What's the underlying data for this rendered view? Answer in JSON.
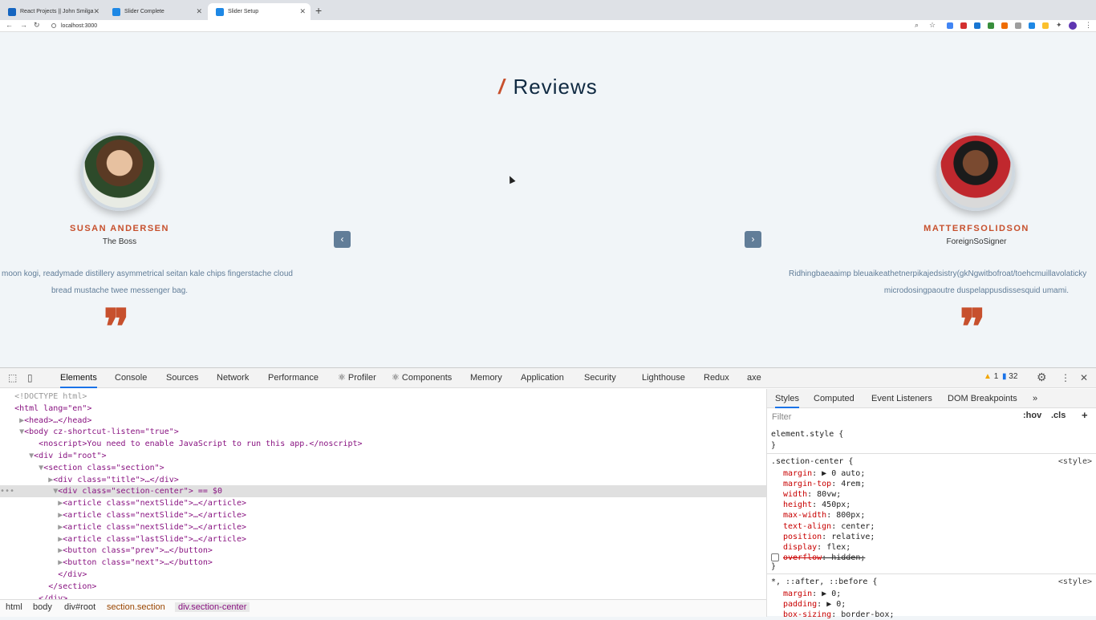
{
  "browser": {
    "tabs": [
      {
        "label": "React Projects || John Smilga",
        "color": "#1565c0"
      },
      {
        "label": "Slider Complete",
        "color": "#1e88e5"
      },
      {
        "label": "Slider Setup",
        "color": "#1e88e5"
      }
    ],
    "new_tab": "+",
    "url": "localhost:3000"
  },
  "page": {
    "title": "Reviews",
    "title_slash": "/",
    "prev_icon": "‹",
    "next_icon": "›",
    "quote_icon": "❞",
    "left_person": {
      "name": "SUSAN ANDERSEN",
      "title": "The Boss",
      "text_line1": "moon kogi, readymade distillery asymmetrical seitan kale chips fingerstache cloud",
      "text_line2": "bread mustache twee messenger bag."
    },
    "right_person": {
      "name": "MATTERFSOLIDSON",
      "title": "ForeignSoSigner",
      "text_line1": "Ridhingbaeaaimp bleuaikeathetnerpikajedsistry(gkNgwitbofroat/toehcmuillavolaticky",
      "text_line2": "microdosingpaoutre duspelappusdissesquid umami."
    }
  },
  "devtools": {
    "tabs": [
      "Elements",
      "Console",
      "Sources",
      "Network",
      "Performance",
      "Profiler",
      "Components",
      "Memory",
      "Application",
      "Security",
      "Lighthouse",
      "Redux",
      "axe"
    ],
    "warnings": "1",
    "messages": "32",
    "more": "»",
    "elements_lines": [
      {
        "indent": "",
        "text": "<!DOCTYPE html>"
      },
      {
        "indent": "",
        "text": "<html lang=\"en\">"
      },
      {
        "indent": " ▶",
        "text": "<head>…</head>"
      },
      {
        "indent": " ▼",
        "text": "<body cz-shortcut-listen=\"true\">"
      },
      {
        "indent": "     ",
        "text": "<noscript>You need to enable JavaScript to run this app.</noscript>"
      },
      {
        "indent": "   ▼",
        "text": "<div id=\"root\">"
      },
      {
        "indent": "     ▼",
        "text": "<section class=\"section\">"
      },
      {
        "indent": "       ▶",
        "text": "<div class=\"title\">…</div>"
      },
      {
        "indent": "       ▼",
        "text": "<div class=\"section-center\"> == $0"
      },
      {
        "indent": "         ▶",
        "text": "<article class=\"nextSlide\">…</article>"
      },
      {
        "indent": "         ▶",
        "text": "<article class=\"nextSlide\">…</article>"
      },
      {
        "indent": "         ▶",
        "text": "<article class=\"nextSlide\">…</article>"
      },
      {
        "indent": "         ▶",
        "text": "<article class=\"lastSlide\">…</article>"
      },
      {
        "indent": "         ▶",
        "text": "<button class=\"prev\">…</button>"
      },
      {
        "indent": "         ▶",
        "text": "<button class=\"next\">…</button>"
      },
      {
        "indent": "         ",
        "text": "</div>"
      },
      {
        "indent": "       ",
        "text": "</section>"
      },
      {
        "indent": "     ",
        "text": "</div>"
      }
    ],
    "selected_gutter": "•••",
    "breadcrumbs": [
      "html",
      "body",
      "div#root",
      "section.section",
      "div.section-center"
    ],
    "styles_tabs": [
      "Styles",
      "Computed",
      "Event Listeners",
      "DOM Breakpoints"
    ],
    "filter_placeholder": "Filter",
    "hov": ":hov",
    "cls": ".cls",
    "plus": "+",
    "element_style_open": "element.style {",
    "close_brace": "}",
    "rule1_selector": ".section-center {",
    "rule1_source": "<style>",
    "rule1_props": [
      "margin: ▶ 0 auto;",
      "margin-top: 4rem;",
      "width: 80vw;",
      "height: 450px;",
      "max-width: 800px;",
      "text-align: center;",
      "position: relative;",
      "display: flex;",
      "overflow: hidden;"
    ],
    "rule2_selector": "*, ::after, ::before {",
    "rule2_source": "<style>",
    "rule2_props": [
      "margin: ▶ 0;",
      "padding: ▶ 0;",
      "box-sizing: border-box;"
    ]
  }
}
